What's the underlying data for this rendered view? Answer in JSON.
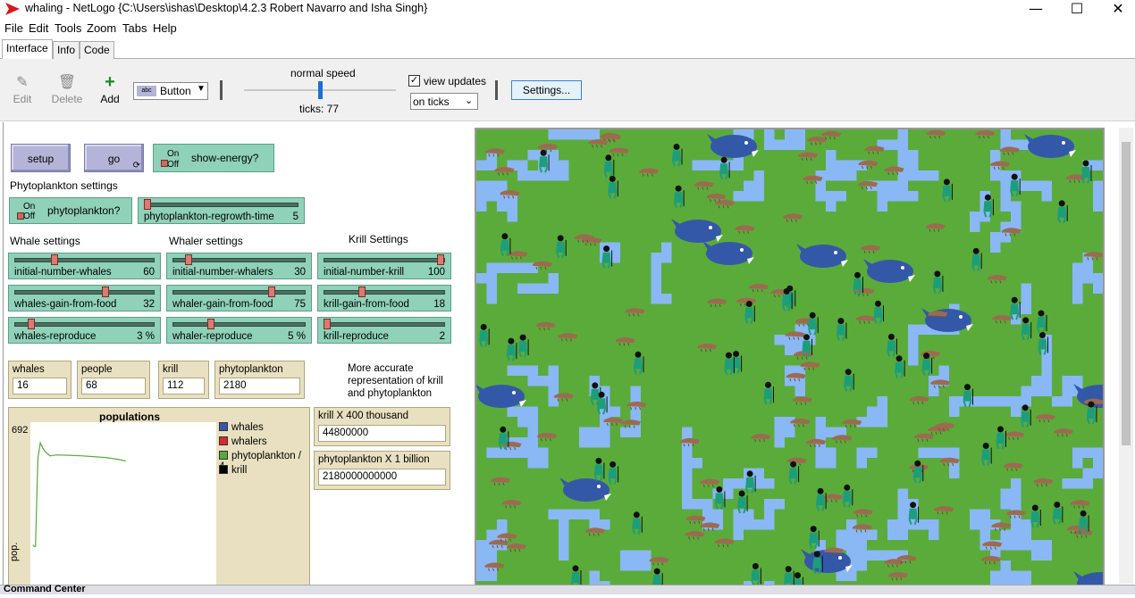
{
  "window": {
    "title": "whaling - NetLogo {C:\\Users\\ishas\\Desktop\\4.2.3 Robert Navarro and Isha Singh}",
    "controls": [
      "—",
      "☐",
      "✕"
    ]
  },
  "menu": [
    "File",
    "Edit",
    "Tools",
    "Zoom",
    "Tabs",
    "Help"
  ],
  "tabs": [
    "Interface",
    "Info",
    "Code"
  ],
  "toolbar": {
    "edit": "Edit",
    "delete": "Delete",
    "add": "Add",
    "widget_type": "Button",
    "speed_label": "normal speed",
    "speed_level": 0.5,
    "ticks": "ticks: 77",
    "view_updates": "view updates",
    "view_updates_checked": true,
    "update_mode": "on ticks",
    "settings": "Settings..."
  },
  "buttons": {
    "setup": "setup",
    "go": "go"
  },
  "switches": {
    "show_energy": {
      "on": "On",
      "off": "Off",
      "label": "show-energy?",
      "value": false
    },
    "phytoplankton": {
      "on": "On",
      "off": "Off",
      "label": "phytoplankton?",
      "value": false
    }
  },
  "sections": {
    "phyto": "Phytoplankton settings",
    "whale": "Whale settings",
    "whaler": "Whaler settings",
    "krill": "Krill Settings"
  },
  "sliders": {
    "regrowth": {
      "label": "phytoplankton-regrowth-time",
      "value": "5",
      "fraction": 0.0
    },
    "init_whales": {
      "label": "initial-number-whales",
      "value": "60",
      "fraction": 0.27
    },
    "init_whalers": {
      "label": "initial-number-whalers",
      "value": "30",
      "fraction": 0.1
    },
    "init_krill": {
      "label": "initial-number-krill",
      "value": "100",
      "fraction": 0.98
    },
    "whales_gain": {
      "label": "whales-gain-from-food",
      "value": "32",
      "fraction": 0.65
    },
    "whaler_gain": {
      "label": "whaler-gain-from-food",
      "value": "75",
      "fraction": 0.75
    },
    "krill_gain": {
      "label": "krill-gain-from-food",
      "value": "18",
      "fraction": 0.3
    },
    "whales_repro": {
      "label": "whales-reproduce",
      "value": "3 %",
      "fraction": 0.1
    },
    "whaler_repro": {
      "label": "whaler-reproduce",
      "value": "5 %",
      "fraction": 0.27
    },
    "krill_repro": {
      "label": "krill-reproduce",
      "value": "2",
      "fraction": 0.0
    }
  },
  "monitors": {
    "whales": {
      "label": "whales",
      "value": "16"
    },
    "people": {
      "label": "people",
      "value": "68"
    },
    "krill": {
      "label": "krill",
      "value": "112"
    },
    "phyto": {
      "label": "phytoplankton",
      "value": "2180"
    },
    "krill_x": {
      "label": "krill X 400 thousand",
      "value": "44800000"
    },
    "phyto_x": {
      "label": "phytoplankton X 1 billion",
      "value": "2180000000000"
    }
  },
  "note": "More accurate representation of krill and phytoplankton",
  "plot": {
    "title": "populations",
    "ymax": "692",
    "ylabel": "pop.",
    "legend": [
      {
        "label": "whales",
        "color": "#3a55a6"
      },
      {
        "label": "whalers",
        "color": "#d42b2b"
      },
      {
        "label": "phytoplankton / 4",
        "color": "#59a83f"
      },
      {
        "label": "krill",
        "color": "#000000"
      }
    ]
  },
  "chart_data": {
    "type": "line",
    "title": "populations",
    "ylabel": "pop.",
    "ylim": [
      0,
      692
    ],
    "series": [
      {
        "name": "phytoplankton / 4",
        "color": "#59a83f",
        "x": [
          0,
          1,
          2,
          4,
          6,
          8,
          10,
          14,
          20,
          30,
          40,
          50,
          60,
          70,
          77
        ],
        "values": [
          60,
          50,
          50,
          560,
          650,
          620,
          600,
          575,
          580,
          578,
          575,
          570,
          565,
          555,
          545
        ]
      }
    ]
  },
  "colors": {
    "ocean": "#5bab3b",
    "phyto_patch": "#8ab8f5",
    "whale": "#3458a8",
    "krill": "#9c6b4f",
    "person": "#1d9e7a"
  },
  "command_center": "Command Center"
}
